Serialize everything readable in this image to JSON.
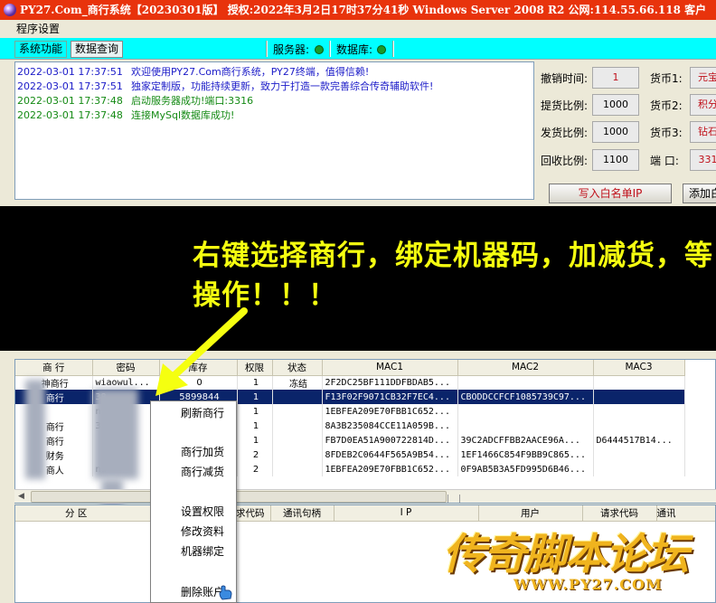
{
  "window": {
    "title": "PY27.Com_商行系统【20230301版】  授权:2022年3月2日17时37分41秒  Windows Server 2008 R2  公网:114.55.66.118  客户"
  },
  "menu": {
    "settings": "程序设置"
  },
  "tabs": [
    {
      "label": "系统功能"
    },
    {
      "label": "数据查询"
    }
  ],
  "status": {
    "server_label": "服务器:",
    "db_label": "数据库:",
    "ok_color": "#1a9a2a"
  },
  "log": [
    {
      "time": "2022-03-01 17:37:51",
      "message": "欢迎使用PY27.Com商行系统，PY27终端，值得信赖!",
      "color": "blue"
    },
    {
      "time": "2022-03-01 17:37:51",
      "message": "独家定制版，功能持续更新，致力于打造一款完善综合传奇辅助软件!",
      "color": "blue"
    },
    {
      "time": "2022-03-01 17:37:48",
      "message": "启动服务器成功!端口:3316",
      "color": "green"
    },
    {
      "time": "2022-03-01 17:37:48",
      "message": "连接MySql数据库成功!",
      "color": "green"
    }
  ],
  "settings": {
    "cancel_time_label": "撤销时间:",
    "cancel_time_value": "1",
    "withdraw_ratio_label": "提货比例:",
    "withdraw_ratio_value": "1000",
    "ship_ratio_label": "发货比例:",
    "ship_ratio_value": "1000",
    "recycle_ratio_label": "回收比例:",
    "recycle_ratio_value": "1100",
    "currency1_label": "货币1:",
    "currency1_value": "元宝",
    "currency2_label": "货币2:",
    "currency2_value": "积分",
    "currency3_label": "货币3:",
    "currency3_value": "钻石",
    "port_label": "端 口:",
    "port_value": "331"
  },
  "buttons": {
    "write_whitelist": "写入白名单IP",
    "add_whitelist": "添加白"
  },
  "annotation": "右键选择商行，绑定机器码，加减货，等操作！！！",
  "table": {
    "columns": [
      "商 行",
      "密码",
      "库存",
      "权限",
      "状态",
      "MAC1",
      "MAC2",
      "MAC3"
    ],
    "rows": [
      [
        "神商行",
        "wiaowul...",
        "0",
        "1",
        "冻结",
        "2F2DC25BF111DDFBDAB5...",
        "",
        ""
      ],
      [
        "商行",
        "38",
        "5899844",
        "1",
        "",
        "F13F02F9071CB32F7EC4...",
        "CBODDCCFCF1085739C97...",
        ""
      ],
      [
        "",
        "na",
        "",
        "1",
        "",
        "1EBFEA209E70FBB1C652...",
        "",
        ""
      ],
      [
        "商行",
        "3",
        "",
        "1",
        "",
        "8A3B235084CCE11A059B...",
        "",
        ""
      ],
      [
        "商行",
        "",
        "",
        "1",
        "",
        "FB7D0EA51A900722814D...",
        "39C2ADCFFBB2AACE96A...",
        "D6444517B14..."
      ],
      [
        "财务",
        "",
        "",
        "2",
        "",
        "8FDEB2C0644F565A9B54...",
        "1EF1466C854F9BB9C865...",
        ""
      ],
      [
        "商人",
        "na",
        "",
        "2",
        "",
        "1EBFEA209E70FBB1C652...",
        "0F9AB5B3A5FD995D6B46...",
        ""
      ]
    ]
  },
  "bottom_table": {
    "columns": [
      "分 区",
      "请求代码",
      "通讯句柄",
      "I  P",
      "用户",
      "请求代码",
      "通讯"
    ]
  },
  "context_menu": [
    {
      "label": "刷新商行"
    },
    {
      "label": "商行加货"
    },
    {
      "label": "商行减货"
    },
    {
      "label": "设置权限"
    },
    {
      "label": "修改资料"
    },
    {
      "label": "机器绑定"
    },
    {
      "label": "删除账户"
    }
  ],
  "watermark": {
    "main": "传奇脚本论坛",
    "url": "WWW.PY27.COM"
  }
}
